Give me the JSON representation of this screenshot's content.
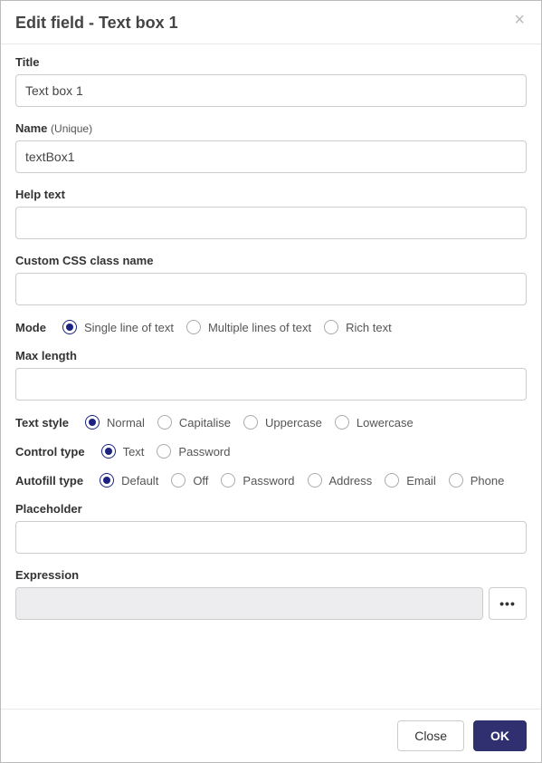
{
  "header": {
    "title": "Edit field - Text box 1"
  },
  "fields": {
    "title": {
      "label": "Title",
      "value": "Text box 1"
    },
    "name": {
      "label": "Name",
      "sub": "(Unique)",
      "value": "textBox1"
    },
    "help": {
      "label": "Help text",
      "value": ""
    },
    "css": {
      "label": "Custom CSS class name",
      "value": ""
    },
    "mode": {
      "label": "Mode",
      "options": [
        "Single line of text",
        "Multiple lines of text",
        "Rich text"
      ],
      "selected": 0
    },
    "maxlen": {
      "label": "Max length",
      "value": ""
    },
    "textstyle": {
      "label": "Text style",
      "options": [
        "Normal",
        "Capitalise",
        "Uppercase",
        "Lowercase"
      ],
      "selected": 0
    },
    "controltype": {
      "label": "Control type",
      "options": [
        "Text",
        "Password"
      ],
      "selected": 0
    },
    "autofill": {
      "label": "Autofill type",
      "options": [
        "Default",
        "Off",
        "Password",
        "Address",
        "Email",
        "Phone"
      ],
      "selected": 0
    },
    "placeholder": {
      "label": "Placeholder",
      "value": ""
    },
    "expression": {
      "label": "Expression",
      "value": "",
      "btn": "•••"
    }
  },
  "footer": {
    "close": "Close",
    "ok": "OK"
  }
}
